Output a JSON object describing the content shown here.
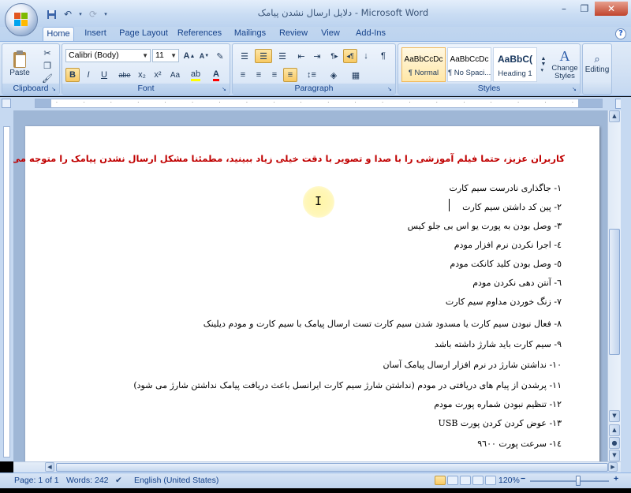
{
  "window": {
    "title": "دلایل ارسال نشدن پیامک - Microsoft Word"
  },
  "ribbon_tabs": [
    "Home",
    "Insert",
    "Page Layout",
    "References",
    "Mailings",
    "Review",
    "View",
    "Add-Ins"
  ],
  "active_tab": "Home",
  "ribbon": {
    "clipboard": {
      "label": "Clipboard",
      "paste": "Paste"
    },
    "font": {
      "label": "Font",
      "font_name": "Calibri (Body)",
      "font_size": "11",
      "buttons": [
        "B",
        "I",
        "U",
        "abe",
        "x₂",
        "x²",
        "Aa"
      ]
    },
    "paragraph": {
      "label": "Paragraph"
    },
    "styles": {
      "label": "Styles",
      "items": [
        {
          "sample": "AaBbCcDc",
          "name": "¶ Normal"
        },
        {
          "sample": "AaBbCcDc",
          "name": "¶ No Spaci..."
        },
        {
          "sample": "AaBbC(",
          "name": "Heading 1"
        }
      ],
      "change_styles": "Change Styles"
    },
    "editing": {
      "label": "Editing"
    }
  },
  "document": {
    "title": "کاربران عزیز، حتما فیلم آموزشی را با صدا و تصویر با دقت خیلی زیاد ببینید، مطمئنا مشکل ارسال نشدن پیامک را متوجه می شوید",
    "lines": [
      "۱-  جاگذاری نادرست سیم کارت",
      "۲-  پین کد داشتن سیم کارت",
      "۳-  وصل بودن به پورت یو اس بی جلو کیس",
      "٤-  اجرا نکردن نرم افزار مودم",
      "٥-  وصل بودن کلید کانکت مودم",
      "٦-  آنتن دهی نکردن مودم",
      "۷-  زنگ خوردن مداوم سیم کارت",
      "۸-  فعال نبودن سیم کارت یا مسدود شدن سیم کارت  تست ارسال پیامک با سیم کارت و مودم دیلینک",
      "۹-  سیم کارت باید شارژ داشته باشد",
      "۱۰- نداشتن شارژ در نرم افزار ارسال پیامک آسان",
      "۱۱- پرشدن از پیام های دریافتی در مودم (نداشتن شارژ سیم کارت ایرانسل باعث دریافت پیامک نداشتن شارژ می شود)",
      "۱۲- تنظیم نبودن شماره پورت مودم",
      "۱۳- عوض کردن کردن پورت USB",
      "۱٤- سرعت پورت ۹٦۰۰"
    ]
  },
  "status": {
    "page": "Page: 1 of 1",
    "words": "Words: 242",
    "language": "English (United States)",
    "zoom": "120%"
  },
  "icons": {
    "office_button": "office-logo-icon",
    "save": "save-icon",
    "undo": "undo-icon",
    "redo": "redo-icon"
  }
}
